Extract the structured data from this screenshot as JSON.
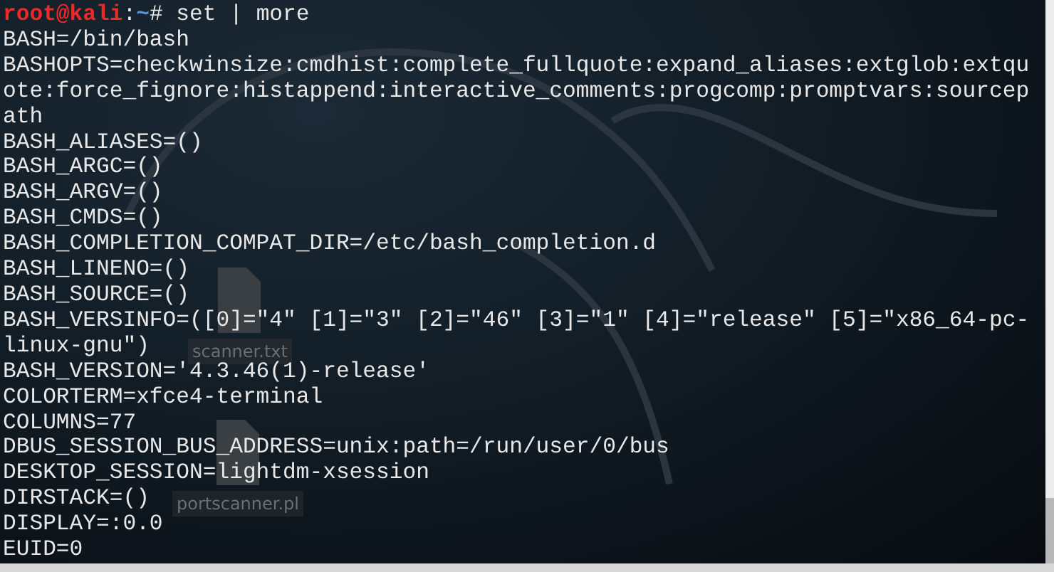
{
  "desktop_icons": [
    {
      "label": "scanner.txt"
    },
    {
      "label": "portscanner.pl"
    }
  ],
  "terminal": {
    "prompt": {
      "user_host": "root@kali",
      "separator": ":",
      "path": "~",
      "symbol": "#",
      "command": "set | more"
    },
    "output_lines": [
      "BASH=/bin/bash",
      "BASHOPTS=checkwinsize:cmdhist:complete_fullquote:expand_aliases:extglob:extqu",
      "ote:force_fignore:histappend:interactive_comments:progcomp:promptvars:sourcep",
      "ath",
      "BASH_ALIASES=()",
      "BASH_ARGC=()",
      "BASH_ARGV=()",
      "BASH_CMDS=()",
      "BASH_COMPLETION_COMPAT_DIR=/etc/bash_completion.d",
      "BASH_LINENO=()",
      "BASH_SOURCE=()",
      "BASH_VERSINFO=([0]=\"4\" [1]=\"3\" [2]=\"46\" [3]=\"1\" [4]=\"release\" [5]=\"x86_64-pc-",
      "linux-gnu\")",
      "BASH_VERSION='4.3.46(1)-release'",
      "COLORTERM=xfce4-terminal",
      "COLUMNS=77",
      "DBUS_SESSION_BUS_ADDRESS=unix:path=/run/user/0/bus",
      "DESKTOP_SESSION=lightdm-xsession",
      "DIRSTACK=()",
      "DISPLAY=:0.0",
      "EUID=0"
    ]
  }
}
